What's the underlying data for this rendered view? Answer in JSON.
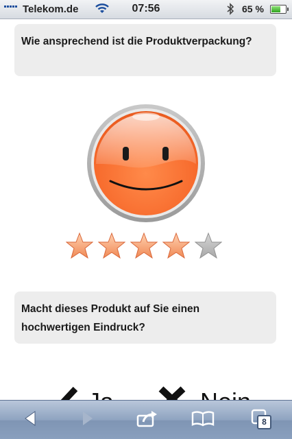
{
  "status_bar": {
    "carrier": "Telekom.de",
    "time": "07:56",
    "battery_percent": "65 %",
    "battery_level": 0.65
  },
  "survey": {
    "question_1": "Wie ansprechend ist die Produktverpackung?",
    "question_2": "Macht dieses Produkt auf Sie einen hochwertigen Eindruck?",
    "rating": {
      "value": 4,
      "max": 5
    },
    "smiley": "smiley-face",
    "answer_yes": "Ja",
    "answer_no": "Nein"
  },
  "toolbar": {
    "tabs_count": "8",
    "icons": [
      "back-icon",
      "forward-icon",
      "share-icon",
      "bookmarks-icon",
      "tabs-icon"
    ]
  },
  "colors": {
    "accent_orange": "#ff7a3d",
    "star_filled": "#f08a55",
    "star_empty": "#a8a8a8",
    "question_bg": "#ededed"
  }
}
